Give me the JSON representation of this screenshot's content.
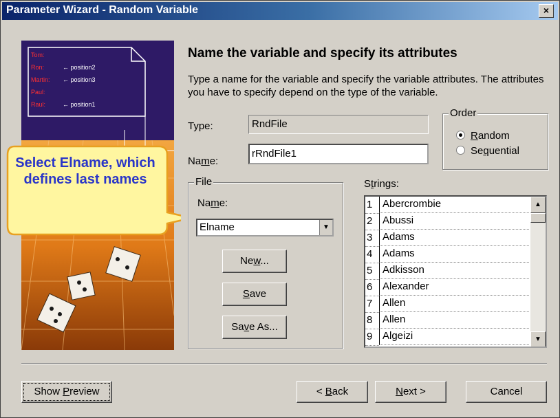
{
  "window": {
    "title": "Parameter Wizard - Random Variable",
    "close_glyph": "×"
  },
  "illustration": {
    "names": [
      "Tom:",
      "Ron:",
      "Martin:",
      "Paul:",
      "Raul:"
    ],
    "notes": [
      "← position2",
      "← position3",
      "← position1"
    ]
  },
  "callout": {
    "text": "Select Elname, which defines last names"
  },
  "content": {
    "heading": "Name the variable and specify its attributes",
    "description": "Type a name for the variable and specify the variable attributes. The attributes you have to specify depend on the type of the variable."
  },
  "type_field": {
    "label": "Type:",
    "value": "RndFile"
  },
  "name_field": {
    "label_pre": "Na",
    "label_u": "m",
    "label_post": "e:",
    "value": "rRndFile1"
  },
  "order": {
    "title": "Order",
    "options": [
      {
        "pre": "",
        "u": "R",
        "post": "andom",
        "selected": true
      },
      {
        "pre": "Se",
        "u": "q",
        "post": "uential",
        "selected": false
      }
    ]
  },
  "file": {
    "title": "File",
    "name_label_pre": "Na",
    "name_label_u": "m",
    "name_label_post": "e:",
    "selected": "Elname",
    "buttons": {
      "new": {
        "pre": "Ne",
        "u": "w",
        "post": "..."
      },
      "save": {
        "pre": "",
        "u": "S",
        "post": "ave"
      },
      "save_as": {
        "pre": "Sa",
        "u": "v",
        "post": "e As..."
      }
    }
  },
  "strings": {
    "label_pre": "S",
    "label_u": "t",
    "label_post": "rings:",
    "rows": [
      {
        "num": "1",
        "value": "Abercrombie"
      },
      {
        "num": "2",
        "value": "Abussi"
      },
      {
        "num": "3",
        "value": "Adams"
      },
      {
        "num": "4",
        "value": "Adams"
      },
      {
        "num": "5",
        "value": "Adkisson"
      },
      {
        "num": "6",
        "value": "Alexander"
      },
      {
        "num": "7",
        "value": "Allen"
      },
      {
        "num": "8",
        "value": "Allen"
      },
      {
        "num": "9",
        "value": "Algeizi"
      }
    ]
  },
  "footer": {
    "show_preview": {
      "pre": "Show ",
      "u": "P",
      "post": "review"
    },
    "back": {
      "pre": "< ",
      "u": "B",
      "post": "ack"
    },
    "next": {
      "pre": "",
      "u": "N",
      "post": "ext >"
    },
    "cancel": "Cancel"
  }
}
